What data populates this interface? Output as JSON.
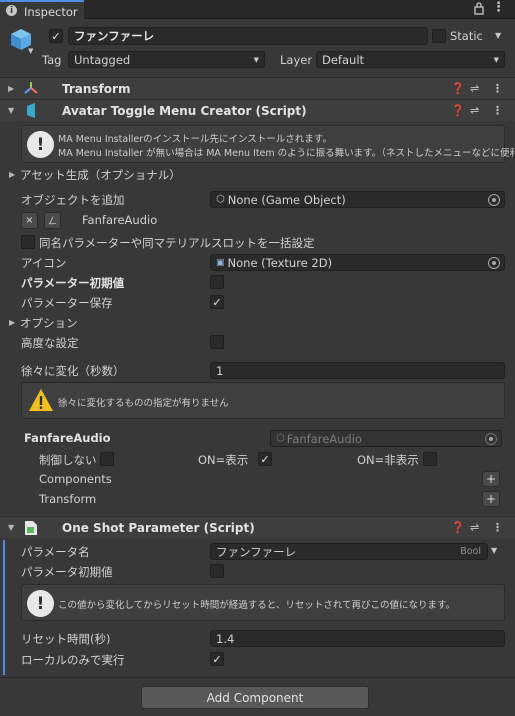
{
  "tab": {
    "label": "Inspector"
  },
  "object": {
    "name": "ファンファーレ",
    "static_label": "Static",
    "tag_label": "Tag",
    "tag_value": "Untagged",
    "layer_label": "Layer",
    "layer_value": "Default"
  },
  "transform": {
    "title": "Transform"
  },
  "toggle_creator": {
    "title": "Avatar Toggle Menu Creator (Script)",
    "info_line1": "MA Menu Installerのインストール先にインストールされます。",
    "info_line2": "MA Menu Installer が無い場合は MA Menu Item のように振る舞います。（ネストしたメニューなどに便利）",
    "asset_gen": "アセット生成（オプショナル）",
    "add_object_label": "オブジェクトを追加",
    "add_object_value": "None (Game Object)",
    "remove_btn": "×",
    "edit_btn": "ㄥ",
    "target_name": "FanfareAudio",
    "bulk_label": "同名パラメーターや同マテリアルスロットを一括設定",
    "icon_label": "アイコン",
    "icon_value": "None (Texture 2D)",
    "param_default_label": "パラメーター初期値",
    "param_save_label": "パラメーター保存",
    "options_label": "オプション",
    "advanced_label": "高度な設定",
    "transition_label": "徐々に変化（秒数）",
    "transition_value": "1",
    "warning_text": "徐々に変化するものの指定が有りません",
    "object_name": "FanfareAudio",
    "object_ref": "FanfareAudio",
    "uncontrolled_label": "制御しない",
    "on_show_label": "ON=表示",
    "on_hide_label": "ON=非表示",
    "components_label": "Components",
    "transform_label": "Transform",
    "plus": "+"
  },
  "oneshot": {
    "title": "One Shot Parameter (Script)",
    "param_name_label": "パラメータ名",
    "param_name_value": "ファンファーレ",
    "param_type": "Bool",
    "param_default_label": "パラメータ初期値",
    "info_text": "この値から変化してからリセット時間が経過すると、リセットされて再びこの値になります。",
    "reset_time_label": "リセット時間(秒)",
    "reset_time_value": "1.4",
    "local_only_label": "ローカルのみで実行"
  },
  "add_component_label": "Add Component",
  "colors": {
    "accent": "#4f8ee0",
    "warning": "#f2c01e",
    "background": "#383838"
  }
}
